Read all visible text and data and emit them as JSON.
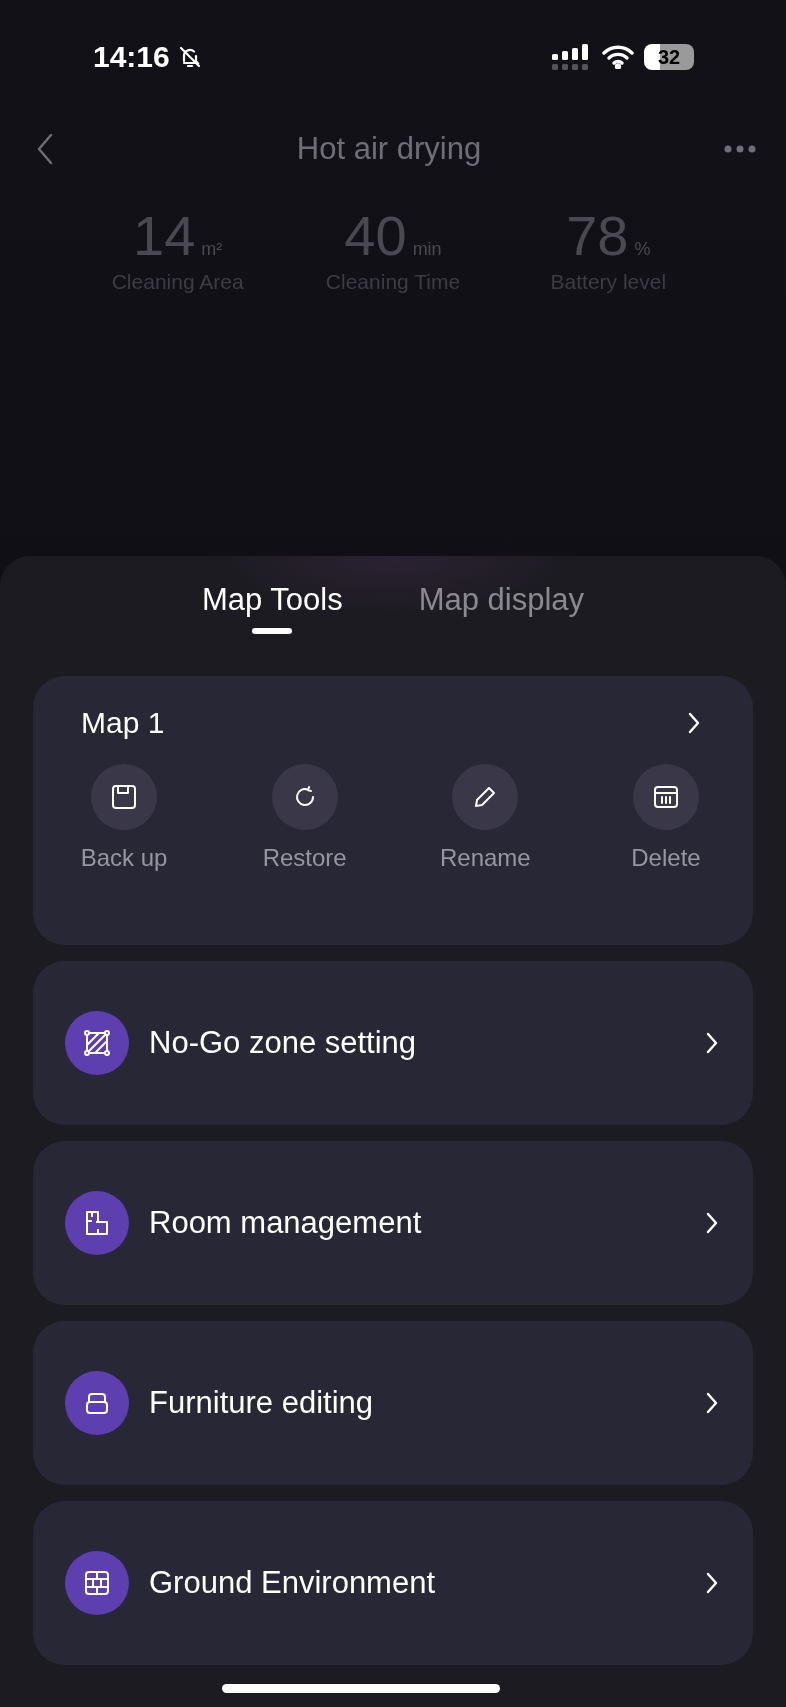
{
  "status_bar": {
    "time": "14:16",
    "battery": "32"
  },
  "header": {
    "title": "Hot air drying"
  },
  "stats": [
    {
      "value": "14",
      "unit": "m²",
      "label": "Cleaning Area"
    },
    {
      "value": "40",
      "unit": "min",
      "label": "Cleaning Time"
    },
    {
      "value": "78",
      "unit": "%",
      "label": "Battery level"
    }
  ],
  "tabs": [
    {
      "label": "Map Tools",
      "selected": true
    },
    {
      "label": "Map display",
      "selected": false
    }
  ],
  "map_card": {
    "title": "Map 1",
    "actions": [
      "Back up",
      "Restore",
      "Rename",
      "Delete"
    ]
  },
  "menu_items": [
    "No-Go zone setting",
    "Room management",
    "Furniture editing",
    "Ground Environment"
  ]
}
